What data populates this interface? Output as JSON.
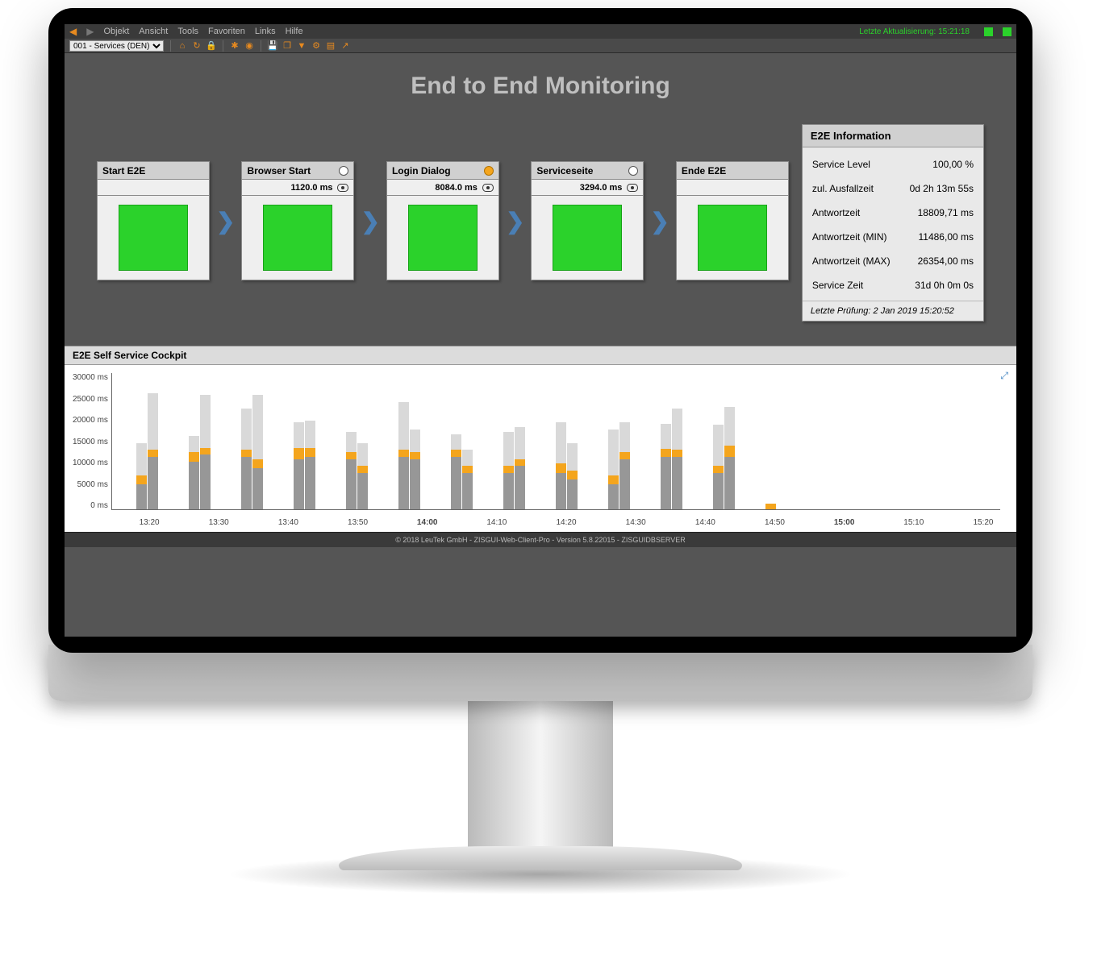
{
  "menubar": {
    "items": [
      "Objekt",
      "Ansicht",
      "Tools",
      "Favoriten",
      "Links",
      "Hilfe"
    ],
    "status_label": "Letzte Aktualisierung: 15:21:18"
  },
  "toolbar": {
    "selector_value": "001 - Services (DEN)"
  },
  "page_title": "End to End Monitoring",
  "flow": [
    {
      "title": "Start E2E",
      "status": "none",
      "row2": ""
    },
    {
      "title": "Browser Start",
      "status": "white",
      "row2": "1120.0 ms"
    },
    {
      "title": "Login Dialog",
      "status": "amber",
      "row2": "8084.0 ms"
    },
    {
      "title": "Serviceseite",
      "status": "white",
      "row2": "3294.0 ms"
    },
    {
      "title": "Ende E2E",
      "status": "none",
      "row2": ""
    }
  ],
  "info": {
    "title": "E2E Information",
    "rows": [
      {
        "k": "Service Level",
        "v": "100,00 %"
      },
      {
        "k": "zul. Ausfallzeit",
        "v": "0d 2h 13m 55s"
      },
      {
        "k": "Antwortzeit",
        "v": "18809,71 ms"
      },
      {
        "k": "Antwortzeit (MIN)",
        "v": "11486,00 ms"
      },
      {
        "k": "Antwortzeit (MAX)",
        "v": "26354,00 ms"
      },
      {
        "k": "Service Zeit",
        "v": "31d 0h 0m 0s"
      }
    ],
    "footer": "Letzte Prüfung: 2 Jan 2019 15:20:52"
  },
  "chart_panel_title": "E2E Self Service Cockpit",
  "footer_text": "© 2018 LeuTek GmbH - ZISGUI-Web-Client-Pro - Version 5.8.22015 - ZISGUIDBSERVER",
  "chart_data": {
    "type": "bar",
    "ylabel": "ms",
    "ylim": [
      0,
      30000
    ],
    "y_ticks": [
      "30000 ms",
      "25000 ms",
      "20000 ms",
      "15000 ms",
      "10000 ms",
      "5000 ms",
      "0 ms"
    ],
    "x_tick_labels": [
      "13:20",
      "13:30",
      "13:40",
      "13:50",
      "14:00",
      "14:10",
      "14:20",
      "14:30",
      "14:40",
      "14:50",
      "15:00",
      "15:10",
      "15:20"
    ],
    "x_bold": [
      "14:00",
      "15:00"
    ],
    "groups": [
      {
        "t": "",
        "bars": [
          {
            "g": 5500,
            "o": 2000,
            "l": 7000
          },
          {
            "g": 11500,
            "o": 1500,
            "l": 12500
          }
        ]
      },
      {
        "t": "13:30",
        "bars": [
          {
            "g": 10500,
            "o": 2000,
            "l": 3500
          },
          {
            "g": 12000,
            "o": 1500,
            "l": 11500
          }
        ]
      },
      {
        "t": "",
        "bars": [
          {
            "g": 11500,
            "o": 1500,
            "l": 9000
          },
          {
            "g": 9000,
            "o": 2000,
            "l": 14000
          }
        ]
      },
      {
        "t": "13:50",
        "bars": [
          {
            "g": 11000,
            "o": 2500,
            "l": 5500
          },
          {
            "g": 11500,
            "o": 2000,
            "l": 6000
          }
        ]
      },
      {
        "t": "",
        "bars": [
          {
            "g": 11000,
            "o": 1500,
            "l": 4500
          },
          {
            "g": 8000,
            "o": 1500,
            "l": 5000
          }
        ]
      },
      {
        "t": "14:10",
        "bars": [
          {
            "g": 11500,
            "o": 1500,
            "l": 10500
          },
          {
            "g": 11000,
            "o": 1500,
            "l": 5000
          }
        ]
      },
      {
        "t": "",
        "bars": [
          {
            "g": 11500,
            "o": 1500,
            "l": 3500
          },
          {
            "g": 8000,
            "o": 1500,
            "l": 3500
          }
        ]
      },
      {
        "t": "14:30",
        "bars": [
          {
            "g": 8000,
            "o": 1500,
            "l": 7500
          },
          {
            "g": 9500,
            "o": 1500,
            "l": 7000
          }
        ]
      },
      {
        "t": "",
        "bars": [
          {
            "g": 8000,
            "o": 2000,
            "l": 9000
          },
          {
            "g": 6500,
            "o": 2000,
            "l": 6000
          }
        ]
      },
      {
        "t": "14:50",
        "bars": [
          {
            "g": 5500,
            "o": 2000,
            "l": 10000
          },
          {
            "g": 11000,
            "o": 1500,
            "l": 6500
          }
        ]
      },
      {
        "t": "",
        "bars": [
          {
            "g": 11500,
            "o": 1800,
            "l": 5500
          },
          {
            "g": 11500,
            "o": 1500,
            "l": 9000
          }
        ]
      },
      {
        "t": "15:10",
        "bars": [
          {
            "g": 8000,
            "o": 1500,
            "l": 9000
          },
          {
            "g": 11500,
            "o": 2500,
            "l": 8500
          }
        ]
      },
      {
        "t": "",
        "bars": [
          {
            "g": 0,
            "o": 1200,
            "l": 0
          }
        ]
      }
    ]
  }
}
